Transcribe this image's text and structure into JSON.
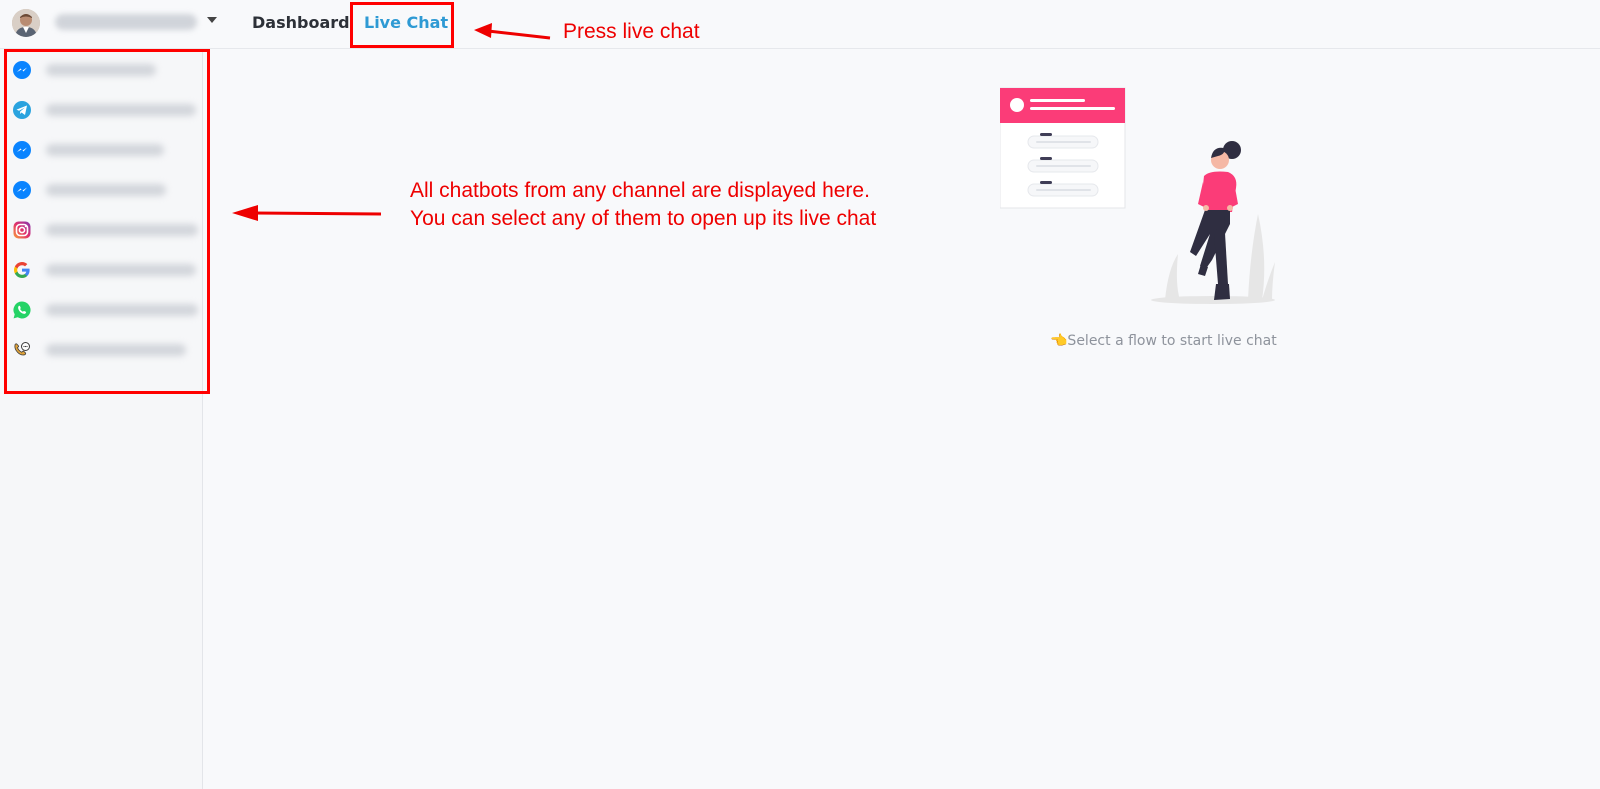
{
  "topbar": {
    "account_name": "",
    "tabs": [
      {
        "label": "Dashboard",
        "active": false
      },
      {
        "label": "Live Chat",
        "active": true
      }
    ]
  },
  "sidebar": {
    "items": [
      {
        "channel": "messenger-icon",
        "name": ""
      },
      {
        "channel": "telegram-icon",
        "name": ""
      },
      {
        "channel": "messenger-icon",
        "name": ""
      },
      {
        "channel": "messenger-icon",
        "name": ""
      },
      {
        "channel": "instagram-icon",
        "name": ""
      },
      {
        "channel": "google-icon",
        "name": ""
      },
      {
        "channel": "whatsapp-icon",
        "name": ""
      },
      {
        "channel": "voice-chat-icon",
        "name": ""
      }
    ]
  },
  "main": {
    "empty_message": "👈Select a flow to start live chat"
  },
  "annotations": {
    "press_live_chat": "Press live chat",
    "chatbots_line1": "All chatbots from any channel are displayed here.",
    "chatbots_line2": "You can select any of them to open up its live chat"
  },
  "colors": {
    "accent": "#2e9ad4",
    "annotation": "#ee0000",
    "illustration_pink": "#fb3c78"
  }
}
